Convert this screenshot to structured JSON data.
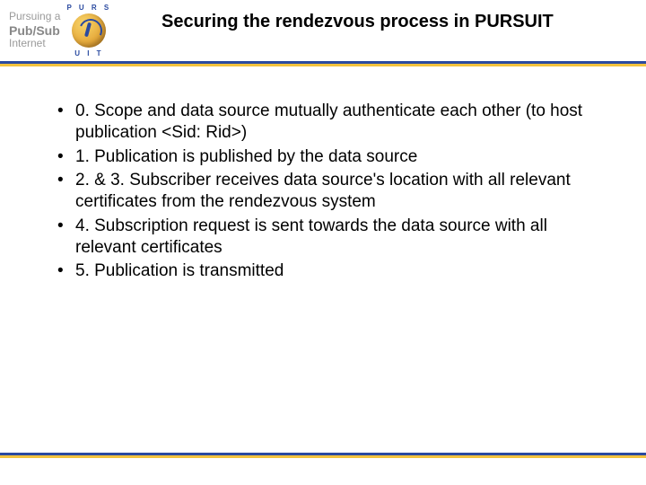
{
  "logo": {
    "line1": "Pursuing a",
    "line2": "Pub/Sub",
    "line3": "Internet",
    "arc_top": "P U R S",
    "arc_bottom": "U I T"
  },
  "title": "Securing the rendezvous process in PURSUIT",
  "bullets": [
    "0. Scope and data source mutually authenticate each other (to host publication <Sid: Rid>)",
    "1. Publication is published by the data source",
    "2. & 3. Subscriber receives data source's location with all relevant certificates from the rendezvous system",
    "4. Subscription request is sent towards the data source with all relevant certificates",
    "5. Publication is transmitted"
  ]
}
